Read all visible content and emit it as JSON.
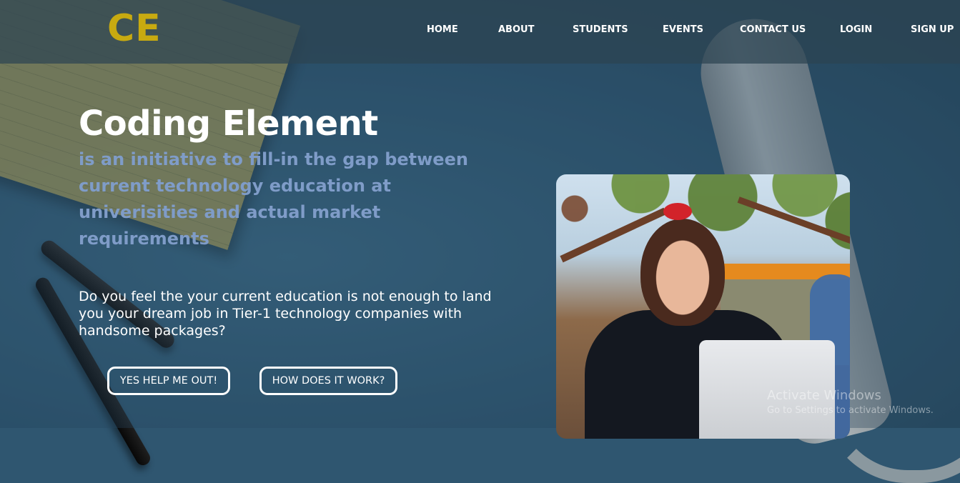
{
  "brand": {
    "logo_text": "CE",
    "logo_color": "#c8aa10"
  },
  "nav": {
    "items": [
      {
        "label": "HOME"
      },
      {
        "label": "ABOUT"
      },
      {
        "label": "STUDENTS"
      },
      {
        "label": "EVENTS"
      },
      {
        "label": "CONTACT US"
      },
      {
        "label": "LOGIN"
      },
      {
        "label": "SIGN UP"
      }
    ]
  },
  "hero": {
    "title": "Coding Element",
    "subtitle": "is an initiative to fill-in the gap between current technology education at univerisities and actual market requirements",
    "subtitle_color": "#7f9cc8",
    "question": "Do you feel the your current education is not enough to land you your dream job in Tier-1 technology companies with handsome packages?",
    "primary_button": "YES HELP ME OUT!",
    "secondary_button": "HOW DOES IT WORK?"
  },
  "watermark": {
    "line1": "Activate Windows",
    "line2": "Go to Settings to activate Windows."
  }
}
